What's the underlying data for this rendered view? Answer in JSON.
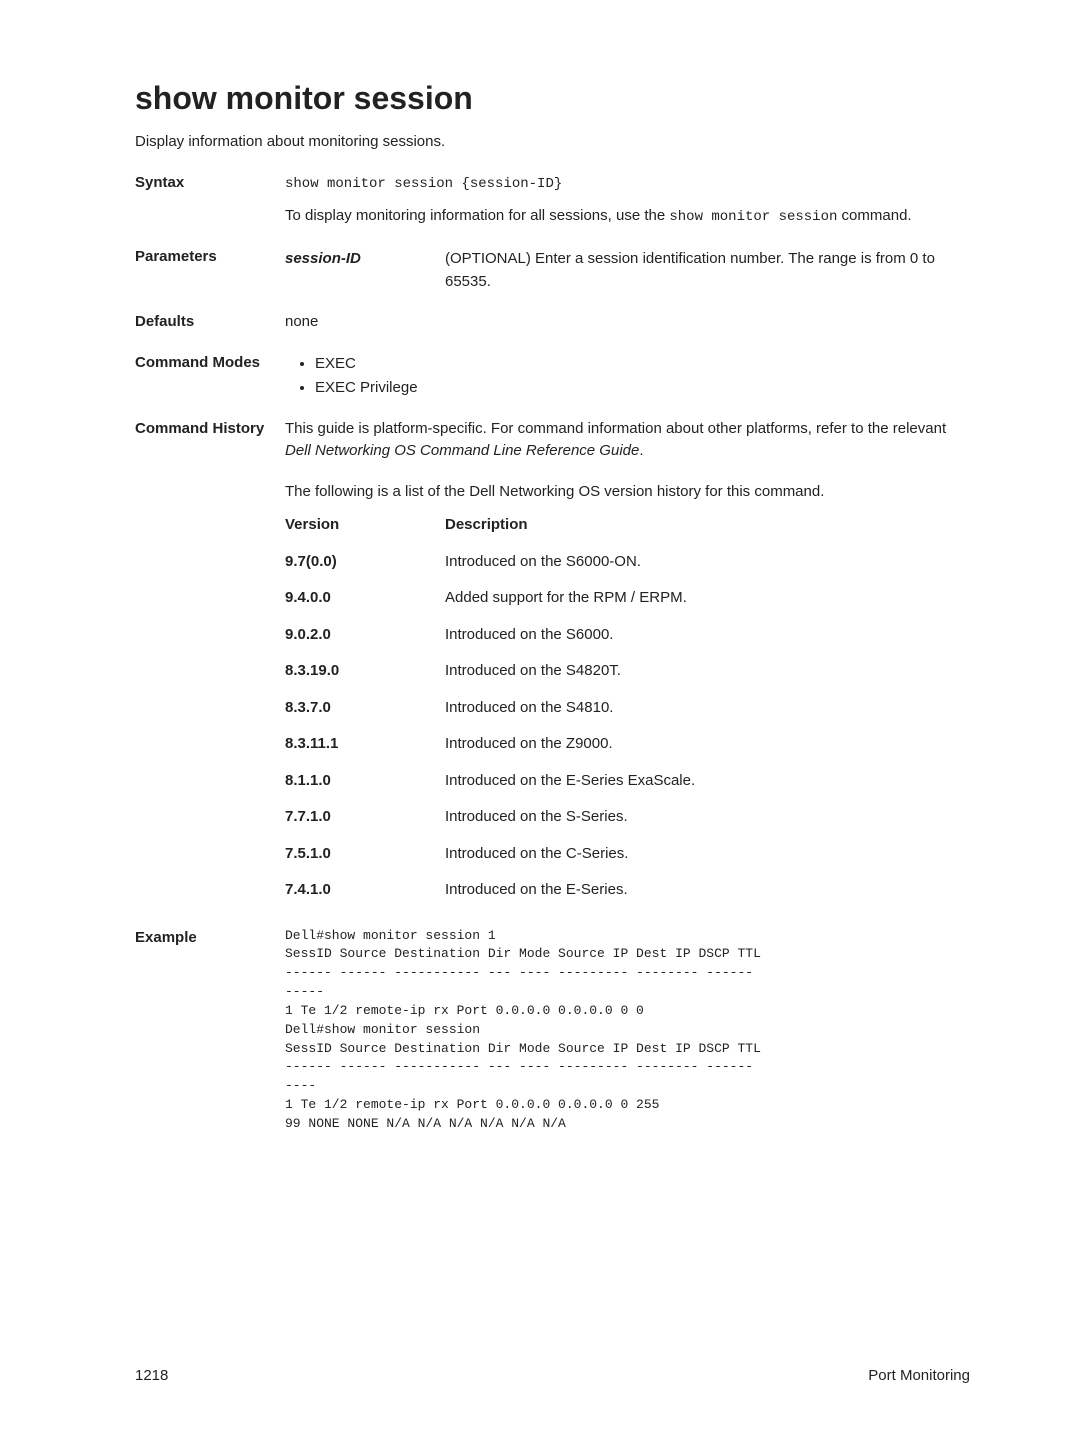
{
  "title": "show monitor session",
  "intro": "Display information about monitoring sessions.",
  "syntax": {
    "label": "Syntax",
    "command": "show monitor session {session-ID}",
    "note_prefix": "To display monitoring information for all sessions, use the ",
    "note_mono1": "show monitor session",
    "note_suffix": " command."
  },
  "parameters": {
    "label": "Parameters",
    "name": "session-ID",
    "desc": "(OPTIONAL) Enter a session identification number. The range is from 0 to 65535."
  },
  "defaults": {
    "label": "Defaults",
    "value": "none"
  },
  "command_modes": {
    "label": "Command Modes",
    "items": [
      "EXEC",
      "EXEC Privilege"
    ]
  },
  "command_history": {
    "label": "Command History",
    "para1_part1": "This guide is platform-specific. For command information about other platforms, refer to the relevant ",
    "para1_italic": "Dell Networking OS Command Line Reference Guide",
    "para1_part2": ".",
    "para2": "The following is a list of the Dell Networking OS version history for this command.",
    "headers": {
      "version": "Version",
      "description": "Description"
    },
    "rows": [
      {
        "v": "9.7(0.0)",
        "d": "Introduced on the S6000-ON."
      },
      {
        "v": "9.4.0.0",
        "d": "Added support for the RPM / ERPM."
      },
      {
        "v": "9.0.2.0",
        "d": "Introduced on the S6000."
      },
      {
        "v": "8.3.19.0",
        "d": "Introduced on the S4820T."
      },
      {
        "v": "8.3.7.0",
        "d": "Introduced on the S4810."
      },
      {
        "v": "8.3.11.1",
        "d": "Introduced on the Z9000."
      },
      {
        "v": "8.1.1.0",
        "d": "Introduced on the E-Series ExaScale."
      },
      {
        "v": "7.7.1.0",
        "d": "Introduced on the S-Series."
      },
      {
        "v": "7.5.1.0",
        "d": "Introduced on the C-Series."
      },
      {
        "v": "7.4.1.0",
        "d": "Introduced on the E-Series."
      }
    ]
  },
  "example": {
    "label": "Example",
    "text": "Dell#show monitor session 1\nSessID Source Destination Dir Mode Source IP Dest IP DSCP TTL\n------ ------ ----------- --- ---- --------- -------- ------\n-----\n1 Te 1/2 remote-ip rx Port 0.0.0.0 0.0.0.0 0 0\nDell#show monitor session\nSessID Source Destination Dir Mode Source IP Dest IP DSCP TTL\n------ ------ ----------- --- ---- --------- -------- ------\n----\n1 Te 1/2 remote-ip rx Port 0.0.0.0 0.0.0.0 0 255\n99 NONE NONE N/A N/A N/A N/A N/A N/A"
  },
  "footer": {
    "page": "1218",
    "section": "Port Monitoring"
  }
}
